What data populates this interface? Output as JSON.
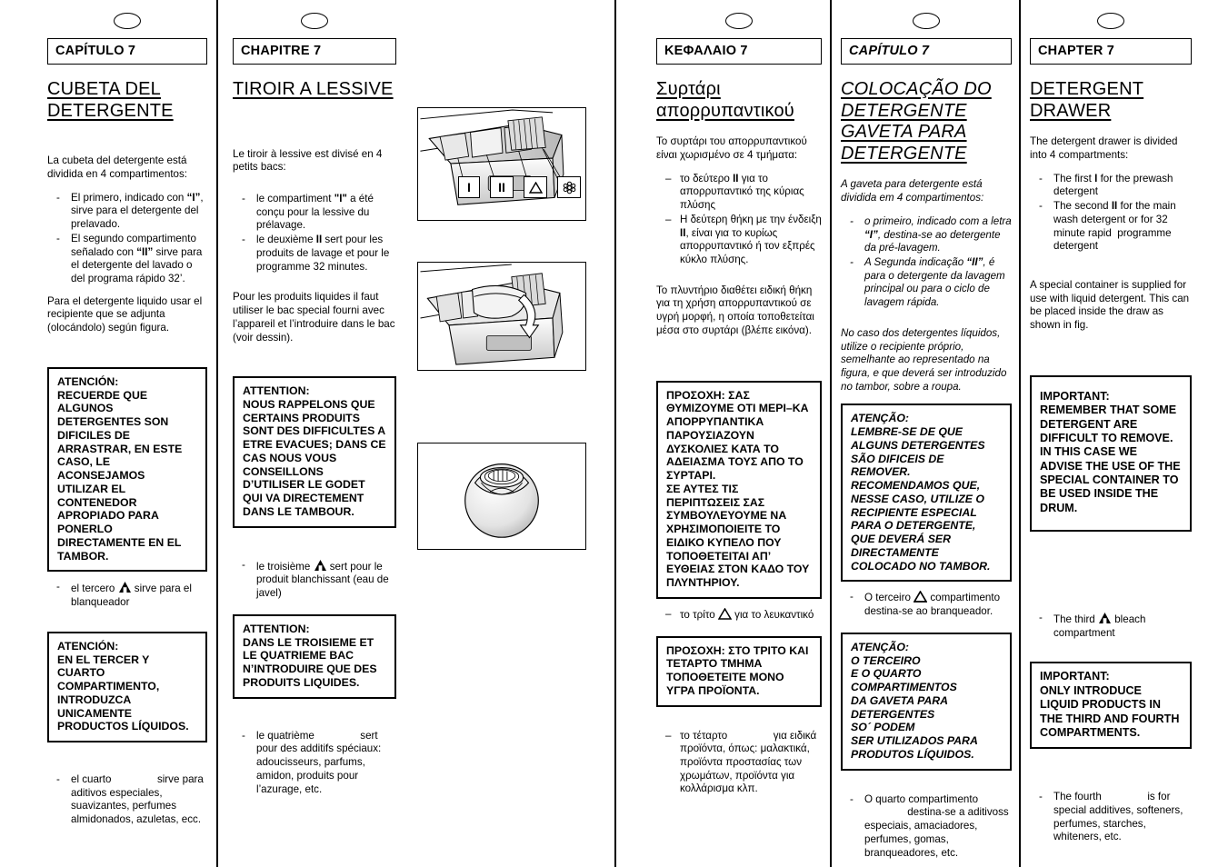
{
  "page": {
    "chapter_number": "7",
    "column_marker_icon": "oval-marker"
  },
  "columns": {
    "es": {
      "lang": "Spanish",
      "chapter_label": "CAPÍTULO 7",
      "title_line1": "CUBETA DEL",
      "title_line2": "DETERGENTE",
      "intro": "La cubeta del detergente está dividida en 4 compartimentos:",
      "bullets": [
        "El primero, indicado con “I”, sirve para el detergente del prelavado.",
        "El segundo compartimento señalado con “II” sirve para el detergente del lavado o del programa rápido 32’."
      ],
      "liquid_note": "Para el detergente liquido usar el recipiente que se adjunta (olocándolo) según figura.",
      "warn1": "ATENCIÓN:\nRECUERDE QUE ALGUNOS DETERGENTES SON DIFICILES DE ARRASTRAR, EN ESTE CASO, LE ACONSEJAMOS UTILIZAR EL CONTENEDOR APROPIADO PARA PONERLO DIRECTAMENTE EN EL TAMBOR.",
      "third_note_pre": "el tercero",
      "third_note_post": "sirve para el blanqueador",
      "warn2": "ATENCIÓN:\nEN EL TERCER Y CUARTO COMPARTIMENTO, INTRODUZCA UNICAMENTE PRODUCTOS LÍQUIDOS.",
      "fourth_note_pre": "el cuarto",
      "fourth_note_post": "sirve para aditivos especiales, suavizantes, perfumes almidonados, azuletas, ecc."
    },
    "fr": {
      "lang": "French",
      "chapter_label": "CHAPITRE 7",
      "title_line1": "TIROIR A LESSIVE",
      "title_line2": "",
      "intro": "Le tiroir à lessive est divisé en 4 petits bacs:",
      "bullets": [
        "le compartiment \"I\" a été conçu pour la lessive du prélavage.",
        "le deuxième II sert pour les produits de lavage et pour le programme 32 minutes."
      ],
      "liquid_note": "Pour les produits liquides il faut utiliser le bac special fourni avec l’appareil et l’introduire dans le bac (voir dessin).",
      "warn1": "ATTENTION:\nNOUS RAPPELONS QUE CERTAINS PRODUITS SONT DES DIFFICULTES A ETRE EVACUES; DANS CE CAS NOUS VOUS CONSEILLONS D’UTILISER LE GODET QUI VA DIRECTEMENT DANS LE TAMBOUR.",
      "third_note_pre": "le troisième",
      "third_note_post": "sert pour le produit blanchissant (eau de javel)",
      "warn2": "ATTENTION:\nDANS LE TROISIEME ET LE QUATRIEME BAC N’INTRODUIRE QUE DES PRODUITS LIQUIDES.",
      "fourth_note_pre": "le quatrième",
      "fourth_note_post": "sert pour des additifs spéciaux: adoucisseurs, parfums, amidon, produits pour l’azurage, etc."
    },
    "el": {
      "lang": "Greek",
      "chapter_label": "ΚΕΦΑΛΑΙΟ 7",
      "title_line1": "Συρτάρι",
      "title_line2": "απορρυπαντικού",
      "intro": "Το συρτάρι του απορρυπαντικού είναι χωρισμένο σε 4 τμήματα:",
      "bullets": [
        "το δεύτερο II για το απορρυπαντικό της κύριας πλύσης",
        "Η δεύτερη θήκη με την ένδειξη II, είναι για το κυρίως απορρυπαντικό ή τον εξπρές κύκλο πλύσης."
      ],
      "liquid_note": "Το πλυντήριο διαθέτει ειδική θήκη για τη χρήση απορρυπαντικού σε υγρή μορφή, η οποία τοποθετείται μέσα στο συρτάρι (βλέπε εικόνα).",
      "warn1": "ΠΡΟΣΟΧΗ: ΣΑΣ ΘΥΜΙΖΟΥΜΕ ΟΤΙ ΜΕΡΙ–ΚΑ ΑΠΟΡΡΥΠΑΝΤΙΚΑ ΠΑΡΟΥΣΙΑΖΟΥΝ ΔΥΣΚΟΛΙΕΣ ΚΑΤΑ ΤΟ ΑΔΕΙΑΣΜΑ ΤΟΥΣ ΑΠΟ ΤΟ ΣΥΡΤΑΡΙ.\nΣΕ ΑΥΤΕΣ ΤΙΣ ΠΕΡΙΠΤΩΣΕΙΣ ΣΑΣ ΣΥΜΒΟΥΛΕΥΟΥΜΕ ΝΑ ΧΡΗΣΙΜΟΠΟΙΕΙΤΕ ΤΟ ΕΙΔΙΚΟ ΚΥΠΕΛΟ ΠΟΥ ΤΟΠΟΘΕΤΕΙΤΑΙ ΑΠ’ ΕΥΘΕΙΑΣ ΣΤΟΝ ΚΑΔΟ ΤΟΥ ΠΛΥΝΤΗΡΙΟΥ.",
      "third_note_pre": "το τρίτο",
      "third_note_post": "για το λευκαντικό",
      "warn2": "ΠΡΟΣΟΧΗ: ΣΤΟ ΤΡΙΤΟ ΚΑΙ ΤΕΤΑΡΤΟ ΤΜΗΜΑ ΤΟΠΟΘΕΤΕΙΤΕ ΜΟΝΟ ΥΓΡΑ ΠΡΟΪΟΝΤΑ.",
      "fourth_note_pre": "το τέταρτο",
      "fourth_note_post": "για ειδικά προϊόντα, όπως: μαλακτικά, προϊόντα προστασίας των χρωμάτων, προϊόντα για κολλάρισμα κλπ."
    },
    "pt": {
      "lang": "Portuguese",
      "chapter_label": "CAPÍTULO 7",
      "title_line1": "COLOCAÇÃO DO",
      "title_line2": "DETERGENTE",
      "title_line3": "GAVETA PARA",
      "title_line4": "DETERGENTE",
      "intro": "A gaveta para detergente está dividida em 4 compartimentos:",
      "bullets": [
        "o primeiro, indicado com a letra “I”, destina-se ao detergente da pré-lavagem.",
        "A Segunda indicação “II”, é para o detergente da lavagem principal ou para o ciclo de lavagem rápida."
      ],
      "liquid_note": "No caso dos detergentes líquidos, utilize o recipiente próprio, semelhante ao representado na figura, e que deverá ser introduzido no tambor, sobre a roupa.",
      "warn1": "ATENÇÃO:\nLEMBRE-SE DE QUE ALGUNS DETERGENTES SÃO DIFICEIS DE REMOVER. RECOMENDAMOS QUE, NESSE CASO, UTILIZE O RECIPIENTE ESPECIAL PARA O DETERGENTE, QUE DEVERÁ SER DIRECTAMENTE COLOCADO NO TAMBOR.",
      "third_note_pre": "O terceiro",
      "third_note_post": "compartimento destina-se ao branqueador.",
      "warn2": "ATENÇÃO:\nO TERCEIRO E O QUARTO COMPARTIMENTOS DA GAVETA PARA DETERGENTES SO´ PODEM SER UTILIZADOS PARA PRODUTOS LÍQUIDOS.",
      "fourth_note_pre": "O quarto compartimento",
      "fourth_note_post": "destina-se a aditivoss especiais, amaciadores, perfumes, gomas, branqueadores, etc."
    },
    "en": {
      "lang": "English",
      "chapter_label": "CHAPTER 7",
      "title_line1": "DETERGENT",
      "title_line2": "DRAWER",
      "intro": "The detergent drawer is divided into 4 compartments:",
      "bullets": [
        "The first I for the prewash detergent",
        "The second II for the main wash detergent or for 32 minute rapid  programme detergent"
      ],
      "liquid_note": "A special container is supplied for use with liquid detergent. This can be placed inside the draw as shown in fig.",
      "warn1": "IMPORTANT:\nREMEMBER THAT SOME DETERGENT ARE DIFFICULT TO REMOVE. IN THIS CASE WE ADVISE THE USE OF THE SPECIAL CONTAINER TO BE USED INSIDE THE DRUM.",
      "third_note_pre": "The third",
      "third_note_post": "bleach compartment",
      "warn2": "IMPORTANT:\nONLY INTRODUCE LIQUID PRODUCTS IN THE THIRD AND FOURTH COMPARTMENTS.",
      "fourth_note_pre": "The fourth",
      "fourth_note_post": "is for special additives, softeners, perfumes, starches, whiteners, etc."
    }
  },
  "figures": {
    "drawer_open": {
      "name": "detergent-drawer-open-illustration",
      "chips": [
        "I",
        "II",
        "△",
        "✿"
      ]
    },
    "drawer_liquid_cup": {
      "name": "liquid-detergent-cup-in-drawer-illustration"
    },
    "drum_ball": {
      "name": "detergent-dosing-ball-illustration"
    }
  },
  "icons": {
    "bleach_triangle": "bleach-triangle-icon",
    "softener_flower": "softener-flower-icon"
  }
}
